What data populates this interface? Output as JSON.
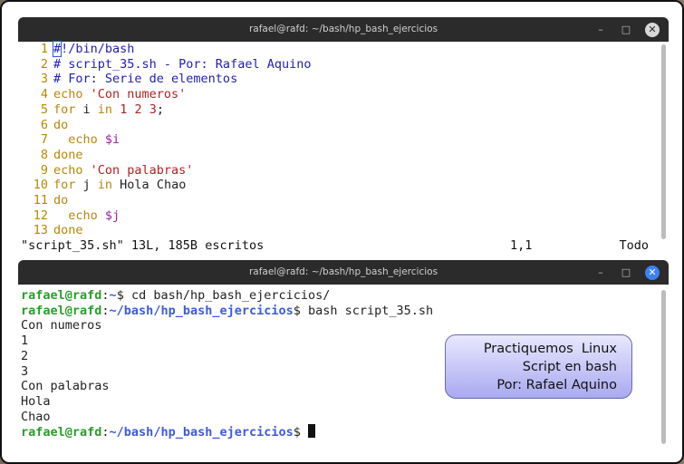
{
  "editor_window": {
    "title": "rafael@rafd: ~/bash/hp_bash_ejercicios",
    "lines": [
      {
        "n": "1",
        "parts": [
          {
            "t": "#",
            "c": "cmt cursor-box"
          },
          {
            "t": "!/bin/bash",
            "c": "cmt"
          }
        ]
      },
      {
        "n": "2",
        "parts": [
          {
            "t": "# script_35.sh - Por: Rafael Aquino",
            "c": "cmt"
          }
        ]
      },
      {
        "n": "3",
        "parts": [
          {
            "t": "# For: Serie de elementos",
            "c": "cmt"
          }
        ]
      },
      {
        "n": "4",
        "parts": [
          {
            "t": "echo ",
            "c": "kw"
          },
          {
            "t": "'Con numeros'",
            "c": "str"
          }
        ]
      },
      {
        "n": "5",
        "parts": [
          {
            "t": "for",
            "c": "kw"
          },
          {
            "t": " i ",
            "c": ""
          },
          {
            "t": "in",
            "c": "kw"
          },
          {
            "t": " ",
            "c": ""
          },
          {
            "t": "1 2 3",
            "c": "num"
          },
          {
            "t": ";",
            "c": ""
          }
        ]
      },
      {
        "n": "6",
        "parts": [
          {
            "t": "do",
            "c": "kw"
          }
        ]
      },
      {
        "n": "7",
        "parts": [
          {
            "t": "  echo ",
            "c": "kw"
          },
          {
            "t": "$i",
            "c": "var"
          }
        ]
      },
      {
        "n": "8",
        "parts": [
          {
            "t": "done",
            "c": "kw"
          }
        ]
      },
      {
        "n": "9",
        "parts": [
          {
            "t": "echo ",
            "c": "kw"
          },
          {
            "t": "'Con palabras'",
            "c": "str"
          }
        ]
      },
      {
        "n": "10",
        "parts": [
          {
            "t": "for",
            "c": "kw"
          },
          {
            "t": " j ",
            "c": ""
          },
          {
            "t": "in",
            "c": "kw"
          },
          {
            "t": " Hola Chao",
            "c": ""
          }
        ]
      },
      {
        "n": "11",
        "parts": [
          {
            "t": "do",
            "c": "kw"
          }
        ]
      },
      {
        "n": "12",
        "parts": [
          {
            "t": "  echo ",
            "c": "kw"
          },
          {
            "t": "$j",
            "c": "var"
          }
        ]
      },
      {
        "n": "13",
        "parts": [
          {
            "t": "done",
            "c": "kw"
          }
        ]
      }
    ],
    "status_file": "\"script_35.sh\" 13L, 185B escritos",
    "status_pos": "1,1",
    "status_all": "Todo"
  },
  "terminal_window": {
    "title": "rafael@rafd: ~/bash/hp_bash_ejercicios",
    "prompt_user": "rafael@rafd",
    "lines": [
      {
        "type": "prompt",
        "path": "~",
        "cmd": "$ cd bash/hp_bash_ejercicios/"
      },
      {
        "type": "prompt",
        "path": "~/bash/hp_bash_ejercicios",
        "cmd": "$ bash script_35.sh"
      },
      {
        "type": "out",
        "text": "Con numeros"
      },
      {
        "type": "out",
        "text": "1"
      },
      {
        "type": "out",
        "text": "2"
      },
      {
        "type": "out",
        "text": "3"
      },
      {
        "type": "out",
        "text": "Con palabras"
      },
      {
        "type": "out",
        "text": "Hola"
      },
      {
        "type": "out",
        "text": "Chao"
      },
      {
        "type": "prompt",
        "path": "~/bash/hp_bash_ejercicios",
        "cmd": "$ ",
        "cursor": true
      }
    ]
  },
  "window_buttons": {
    "minimize": "–",
    "maximize": "□",
    "close": "✕"
  },
  "overlay": {
    "line1": "Practiquemos  Linux",
    "line2": "Script en bash",
    "line3": "Por: Rafael Aquino"
  }
}
